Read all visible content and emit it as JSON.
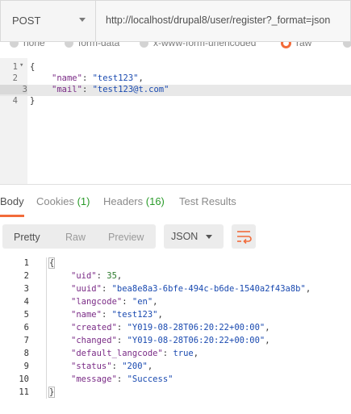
{
  "request": {
    "method": "POST",
    "url": "http://localhost/drupal8/user/register?_format=json"
  },
  "body_types": [
    {
      "label": "none",
      "selected": false
    },
    {
      "label": "form-data",
      "selected": false
    },
    {
      "label": "x-www-form-urlencoded",
      "selected": false
    },
    {
      "label": "raw",
      "selected": true
    },
    {
      "label": "bi",
      "selected": false
    }
  ],
  "request_body": {
    "lines": [
      {
        "num": "1",
        "fold": "▾",
        "text": "{"
      },
      {
        "num": "2",
        "key": "\"name\"",
        "value": "\"test123\"",
        "suffix": ","
      },
      {
        "num": "3",
        "key": "\"mail\"",
        "value": "\"test123@t.com\"",
        "suffix": ""
      },
      {
        "num": "4",
        "text": "}"
      }
    ],
    "active_line": "3"
  },
  "response_tabs": [
    {
      "label": "Body",
      "count": "",
      "active": true
    },
    {
      "label": "Cookies",
      "count": "(1)",
      "active": false
    },
    {
      "label": "Headers",
      "count": "(16)",
      "active": false
    },
    {
      "label": "Test Results",
      "count": "",
      "active": false
    }
  ],
  "format_toolbar": {
    "views": [
      "Pretty",
      "Raw",
      "Preview"
    ],
    "active_view": "Pretty",
    "language": "JSON",
    "wrap_icon": "wrap-lines-icon"
  },
  "response_body": {
    "lines": [
      {
        "num": "1",
        "text": "{"
      },
      {
        "num": "2",
        "key": "\"uid\"",
        "value": "35",
        "suffix": ","
      },
      {
        "num": "3",
        "key": "\"uuid\"",
        "value": "\"bea8e8a3-6bfe-494c-b6de-1540a2f43a8b\"",
        "suffix": ","
      },
      {
        "num": "4",
        "key": "\"langcode\"",
        "value": "\"en\"",
        "suffix": ","
      },
      {
        "num": "5",
        "key": "\"name\"",
        "value": "\"test123\"",
        "suffix": ","
      },
      {
        "num": "6",
        "key": "\"created\"",
        "value": "\"Y019-08-28T06:20:22+00:00\"",
        "suffix": ","
      },
      {
        "num": "7",
        "key": "\"changed\"",
        "value": "\"Y019-08-28T06:20:22+00:00\"",
        "suffix": ","
      },
      {
        "num": "8",
        "key": "\"default_langcode\"",
        "value": "true",
        "suffix": ","
      },
      {
        "num": "9",
        "key": "\"status\"",
        "value": "\"200\"",
        "suffix": ","
      },
      {
        "num": "10",
        "key": "\"message\"",
        "value": "\"Success\"",
        "suffix": ""
      },
      {
        "num": "11",
        "text": "}"
      }
    ]
  },
  "colors": {
    "accent": "#f26b3a",
    "count_green": "#2a9b2a",
    "json_key": "#7a2b86",
    "json_string": "#1a4ab0"
  }
}
